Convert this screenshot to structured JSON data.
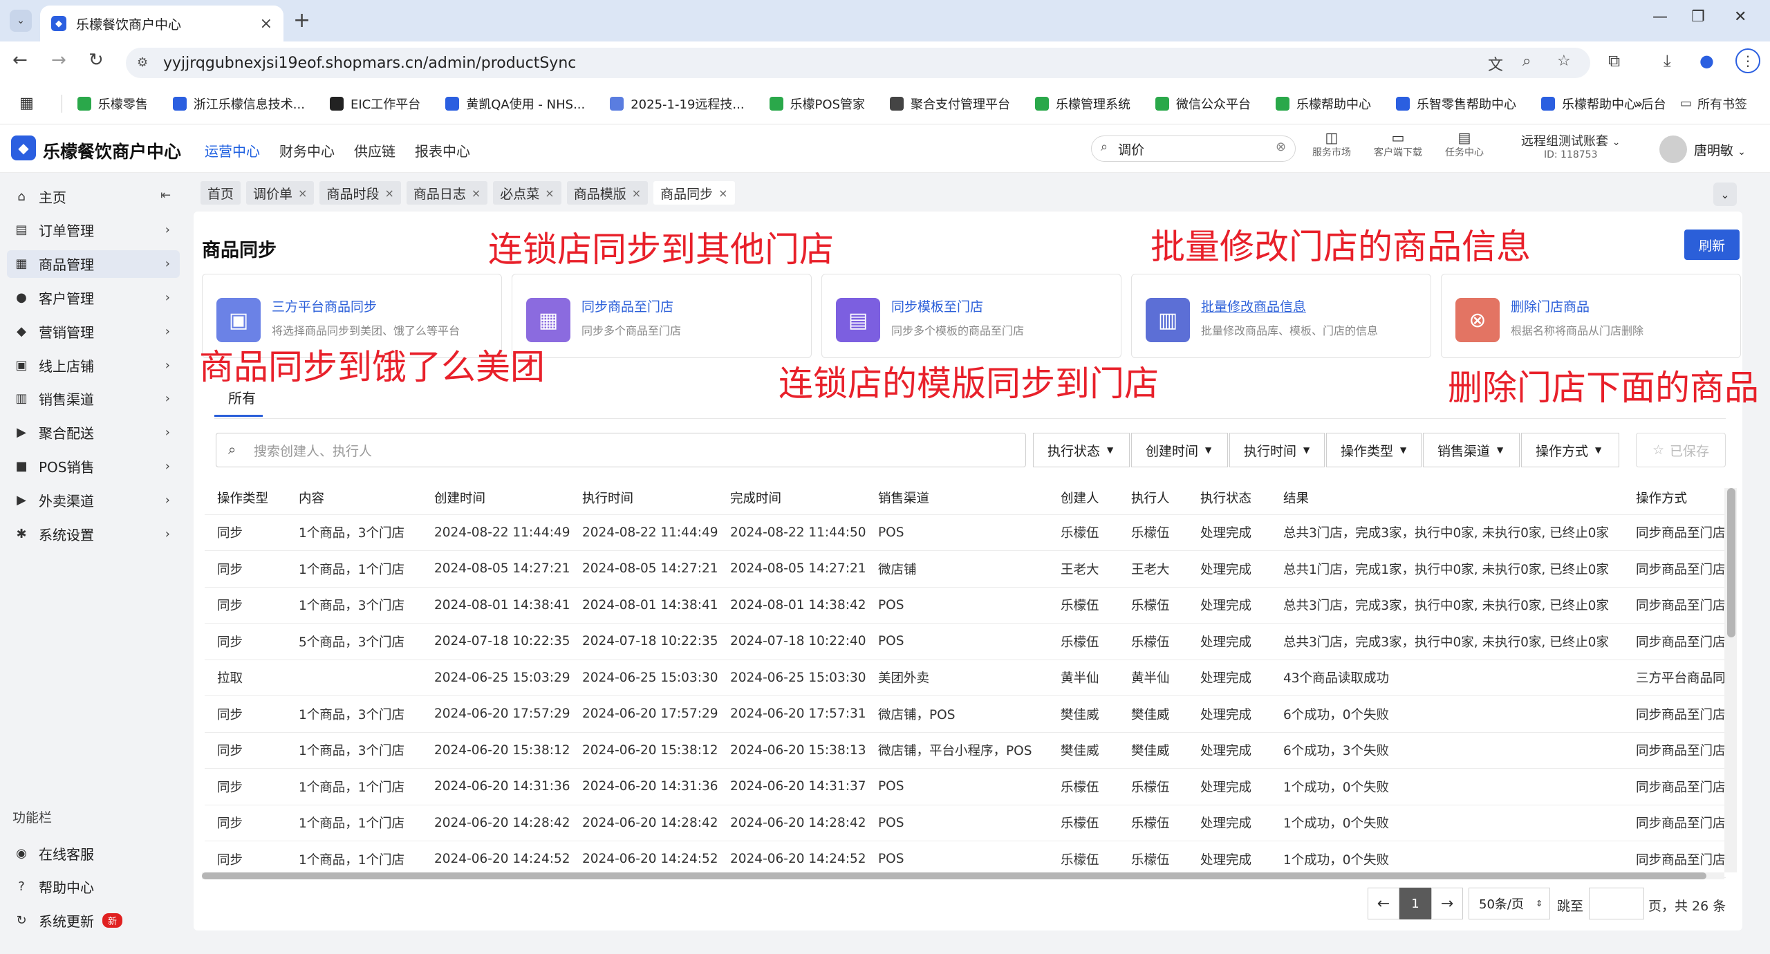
{
  "browser": {
    "tab_title": "乐檬餐饮商户中心",
    "url": "yyjjrqgubnexjsi19eof.shopmars.cn/admin/productSync",
    "bookmarks": [
      {
        "label": "乐檬零售",
        "color": "#2aa84a"
      },
      {
        "label": "浙江乐檬信息技术...",
        "color": "#2b5fe0"
      },
      {
        "label": "EIC工作平台",
        "color": "#222222"
      },
      {
        "label": "黄凯QA使用 - NHS...",
        "color": "#2b5fe0"
      },
      {
        "label": "2025-1-19远程技...",
        "color": "#5a7de0"
      },
      {
        "label": "乐檬POS管家",
        "color": "#2aa84a"
      },
      {
        "label": "聚合支付管理平台",
        "color": "#444444"
      },
      {
        "label": "乐檬管理系统",
        "color": "#2aa84a"
      },
      {
        "label": "微信公众平台",
        "color": "#2aa84a"
      },
      {
        "label": "乐檬帮助中心",
        "color": "#2aa84a"
      },
      {
        "label": "乐智零售帮助中心",
        "color": "#2b5fe0"
      },
      {
        "label": "乐檬帮助中心-后台",
        "color": "#2b5fe0"
      }
    ],
    "all_bookmarks": "所有书签"
  },
  "header": {
    "logo_text": "乐檬餐饮商户中心",
    "nav": [
      "运营中心",
      "财务中心",
      "供应链",
      "报表中心"
    ],
    "search_value": "调价",
    "icons": [
      "服务市场",
      "客户端下载",
      "任务中心"
    ],
    "account_name": "远程组测试账套",
    "account_id": "ID: 118753",
    "user_name": "唐明敏"
  },
  "sidebar": {
    "items": [
      {
        "label": "主页",
        "icon": "home-icon",
        "glyph": "⌂"
      },
      {
        "label": "订单管理",
        "icon": "order-icon",
        "glyph": "▤"
      },
      {
        "label": "商品管理",
        "icon": "product-icon",
        "glyph": "▦"
      },
      {
        "label": "客户管理",
        "icon": "user-icon",
        "glyph": "●"
      },
      {
        "label": "营销管理",
        "icon": "tag-icon",
        "glyph": "◆"
      },
      {
        "label": "线上店铺",
        "icon": "store-icon",
        "glyph": "▣"
      },
      {
        "label": "销售渠道",
        "icon": "channel-icon",
        "glyph": "▥"
      },
      {
        "label": "聚合配送",
        "icon": "delivery-icon",
        "glyph": "▶"
      },
      {
        "label": "POS销售",
        "icon": "pos-icon",
        "glyph": "■"
      },
      {
        "label": "外卖渠道",
        "icon": "takeout-icon",
        "glyph": "▶"
      },
      {
        "label": "系统设置",
        "icon": "gear-icon",
        "glyph": "✱"
      }
    ],
    "section_label": "功能栏",
    "footer": [
      {
        "label": "在线客服",
        "glyph": "◉"
      },
      {
        "label": "帮助中心",
        "glyph": "?"
      },
      {
        "label": "系统更新",
        "glyph": "↻",
        "badge": "新"
      }
    ]
  },
  "page_tabs": [
    "首页",
    "调价单",
    "商品时段",
    "商品日志",
    "必点菜",
    "商品模版",
    "商品同步"
  ],
  "page": {
    "title": "商品同步",
    "refresh": "刷新",
    "cards": [
      {
        "title": "三方平台商品同步",
        "desc": "将选择商品同步到美团、饿了么等平台",
        "color": "#6b82e6"
      },
      {
        "title": "同步商品至门店",
        "desc": "同步多个商品至门店",
        "color": "#8b6bdf"
      },
      {
        "title": "同步模板至门店",
        "desc": "同步多个模板的商品至门店",
        "color": "#7c5fe0"
      },
      {
        "title": "批量修改商品信息",
        "desc": "批量修改商品库、模板、门店的信息",
        "color": "#5c6fd6"
      },
      {
        "title": "删除门店商品",
        "desc": "根据名称将商品从门店删除",
        "color": "#e37463"
      }
    ],
    "annotations": [
      "连锁店同步到其他门店",
      "批量修改门店的商品信息",
      "商品同步到饿了么美团",
      "连锁店的模版同步到门店",
      "删除门店下面的商品"
    ],
    "sub_tab": "所有",
    "search_placeholder": "搜索创建人、执行人",
    "filters": [
      "执行状态",
      "创建时间",
      "执行时间",
      "操作类型",
      "销售渠道",
      "操作方式"
    ],
    "saved": "已保存",
    "columns": [
      "操作类型",
      "内容",
      "创建时间",
      "执行时间",
      "完成时间",
      "销售渠道",
      "创建人",
      "执行人",
      "执行状态",
      "结果",
      "操作方式"
    ],
    "rows": [
      [
        "同步",
        "1个商品，3个门店",
        "2024-08-22 11:44:49",
        "2024-08-22 11:44:49",
        "2024-08-22 11:44:50",
        "POS",
        "乐檬伍",
        "乐檬伍",
        "处理完成",
        "总共3门店，完成3家，执行中0家, 未执行0家, 已终止0家",
        "同步商品至门店"
      ],
      [
        "同步",
        "1个商品，1个门店",
        "2024-08-05 14:27:21",
        "2024-08-05 14:27:21",
        "2024-08-05 14:27:21",
        "微店铺",
        "王老大",
        "王老大",
        "处理完成",
        "总共1门店，完成1家，执行中0家, 未执行0家, 已终止0家",
        "同步商品至门店"
      ],
      [
        "同步",
        "1个商品，3个门店",
        "2024-08-01 14:38:41",
        "2024-08-01 14:38:41",
        "2024-08-01 14:38:42",
        "POS",
        "乐檬伍",
        "乐檬伍",
        "处理完成",
        "总共3门店，完成3家，执行中0家, 未执行0家, 已终止0家",
        "同步商品至门店"
      ],
      [
        "同步",
        "5个商品，3个门店",
        "2024-07-18 10:22:35",
        "2024-07-18 10:22:35",
        "2024-07-18 10:22:40",
        "POS",
        "乐檬伍",
        "乐檬伍",
        "处理完成",
        "总共3门店，完成3家，执行中0家, 未执行0家, 已终止0家",
        "同步商品至门店"
      ],
      [
        "拉取",
        "",
        "2024-06-25 15:03:29",
        "2024-06-25 15:03:30",
        "2024-06-25 15:03:30",
        "美团外卖",
        "黄半仙",
        "黄半仙",
        "处理完成",
        "43个商品读取成功",
        "三方平台商品同步"
      ],
      [
        "同步",
        "1个商品，3个门店",
        "2024-06-20 17:57:29",
        "2024-06-20 17:57:29",
        "2024-06-20 17:57:31",
        "微店铺，POS",
        "樊佳威",
        "樊佳威",
        "处理完成",
        "6个成功，0个失败",
        "同步商品至门店"
      ],
      [
        "同步",
        "1个商品，3个门店",
        "2024-06-20 15:38:12",
        "2024-06-20 15:38:12",
        "2024-06-20 15:38:13",
        "微店铺，平台小程序，POS",
        "樊佳威",
        "樊佳威",
        "处理完成",
        "6个成功，3个失败",
        "同步商品至门店"
      ],
      [
        "同步",
        "1个商品，1个门店",
        "2024-06-20 14:31:36",
        "2024-06-20 14:31:36",
        "2024-06-20 14:31:37",
        "POS",
        "乐檬伍",
        "乐檬伍",
        "处理完成",
        "1个成功，0个失败",
        "同步商品至门店"
      ],
      [
        "同步",
        "1个商品，1个门店",
        "2024-06-20 14:28:42",
        "2024-06-20 14:28:42",
        "2024-06-20 14:28:42",
        "POS",
        "乐檬伍",
        "乐檬伍",
        "处理完成",
        "1个成功，0个失败",
        "同步商品至门店"
      ],
      [
        "同步",
        "1个商品，1个门店",
        "2024-06-20 14:24:52",
        "2024-06-20 14:24:52",
        "2024-06-20 14:24:52",
        "POS",
        "乐檬伍",
        "乐檬伍",
        "处理完成",
        "1个成功，0个失败",
        "同步商品至门店"
      ]
    ],
    "pagination": {
      "current": "1",
      "page_size": "50条/页",
      "goto_label": "跳至",
      "total_label": "页，共 26 条"
    }
  }
}
